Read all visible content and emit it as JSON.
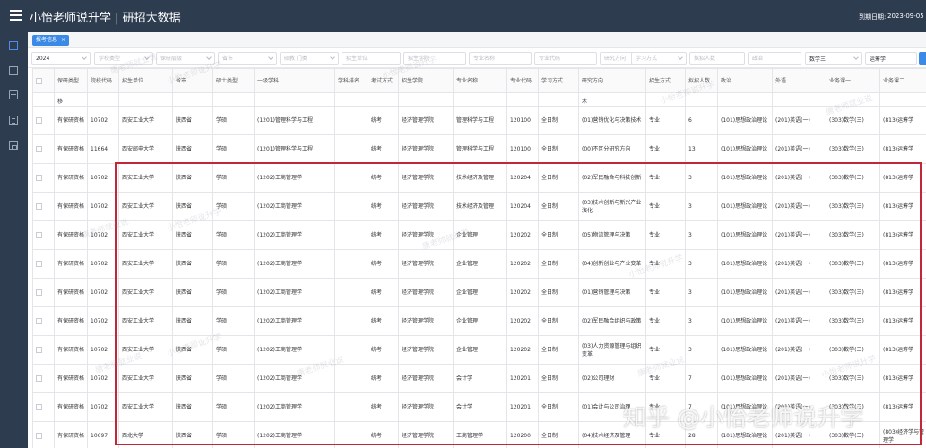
{
  "header": {
    "title": "小怡老师说升学 | 研招大数据",
    "report_date_label": "到期日期:",
    "report_date_value": "2023-09-05 17"
  },
  "tab": {
    "label": "报考信息",
    "close": "×"
  },
  "filters": [
    {
      "id": "year",
      "value": "2024",
      "placeholder": "",
      "has_chevron": true
    },
    {
      "id": "category",
      "value": "",
      "placeholder": "学校类型",
      "has_chevron": true
    },
    {
      "id": "level",
      "value": "",
      "placeholder": "保研层级",
      "has_chevron": true
    },
    {
      "id": "province",
      "value": "",
      "placeholder": "省市",
      "has_chevron": true
    },
    {
      "id": "program",
      "value": "",
      "placeholder": "硕教 门类",
      "has_chevron": true
    },
    {
      "id": "unit",
      "value": "",
      "placeholder": "招生单位",
      "has_chevron": false
    },
    {
      "id": "school",
      "value": "",
      "placeholder": "招生学院",
      "has_chevron": false
    },
    {
      "id": "major",
      "value": "",
      "placeholder": "专业名称",
      "has_chevron": false
    },
    {
      "id": "code",
      "value": "",
      "placeholder": "专业代码",
      "has_chevron": false
    },
    {
      "id": "direction",
      "value": "",
      "placeholder": "研究方向",
      "has_chevron": false
    },
    {
      "id": "mode",
      "value": "",
      "placeholder": "学习方式",
      "has_chevron": true
    },
    {
      "id": "plan",
      "value": "",
      "placeholder": "拟招人数",
      "has_chevron": false
    },
    {
      "id": "politics",
      "value": "",
      "placeholder": "政治",
      "has_chevron": false
    },
    {
      "id": "math",
      "value": "数学三",
      "placeholder": "",
      "has_chevron": true
    },
    {
      "id": "subject2",
      "value": "运筹学",
      "placeholder": "",
      "has_chevron": false
    }
  ],
  "table": {
    "columns": [
      "",
      "保研类型",
      "院校代码",
      "招生单位",
      "省市",
      "硕士类型",
      "一级学科",
      "学科排名",
      "考试方式",
      "招生学院",
      "专业名称",
      "专业代码",
      "学习方式",
      "研究方向",
      "招生方式",
      "拟招人数",
      "政治",
      "外语",
      "业务课一",
      "业务课二"
    ],
    "partial_row": [
      "",
      "移",
      "",
      "",
      "",
      "",
      "",
      "",
      "",
      "",
      "",
      "",
      "",
      "术",
      "",
      "",
      "",
      "",
      "",
      ""
    ],
    "rows": [
      [
        "",
        "有保研资格",
        "10702",
        "西安工业大学",
        "陕西省",
        "学硕",
        "(1201)管理科学与工程",
        "",
        "统考",
        "经济管理学院",
        "管理科学与工程",
        "120100",
        "全日制",
        "(01)营销优化与决策技术",
        "专业",
        "6",
        "(101)思想政治理论",
        "(201)英语(一)",
        "(303)数学(三)",
        "(813)运筹学"
      ],
      [
        "",
        "有保研资格",
        "11664",
        "西安邮电大学",
        "陕西省",
        "学硕",
        "(1201)管理科学与工程",
        "",
        "统考",
        "经济管理学院",
        "管理科学与工程",
        "120100",
        "全日制",
        "(00)不区分研究方向",
        "专业",
        "13",
        "(101)思想政治理论",
        "(201)英语(一)",
        "(303)数学(三)",
        "(813)运筹学"
      ],
      [
        "",
        "有保研资格",
        "10702",
        "西安工业大学",
        "陕西省",
        "学硕",
        "(1202)工商管理学",
        "",
        "统考",
        "经济管理学院",
        "技术经济及管理",
        "120204",
        "全日制",
        "(02)军民融合与科技创新",
        "专业",
        "3",
        "(101)思想政治理论",
        "(201)英语(一)",
        "(303)数学(三)",
        "(813)运筹学"
      ],
      [
        "",
        "有保研资格",
        "10702",
        "西安工业大学",
        "陕西省",
        "学硕",
        "(1202)工商管理学",
        "",
        "统考",
        "经济管理学院",
        "技术经济及管理",
        "120204",
        "全日制",
        "(03)技术创新与新兴产业演化",
        "专业",
        "3",
        "(101)思想政治理论",
        "(201)英语(一)",
        "(303)数学(三)",
        "(813)运筹学"
      ],
      [
        "",
        "有保研资格",
        "10702",
        "西安工业大学",
        "陕西省",
        "学硕",
        "(1202)工商管理学",
        "",
        "统考",
        "经济管理学院",
        "企业管理",
        "120202",
        "全日制",
        "(05)物流管理与决策",
        "专业",
        "3",
        "(101)思想政治理论",
        "(201)英语(一)",
        "(303)数学(三)",
        "(813)运筹学"
      ],
      [
        "",
        "有保研资格",
        "10702",
        "西安工业大学",
        "陕西省",
        "学硕",
        "(1202)工商管理学",
        "",
        "统考",
        "经济管理学院",
        "企业管理",
        "120202",
        "全日制",
        "(04)创新创业与产业变革",
        "专业",
        "3",
        "(101)思想政治理论",
        "(201)英语(一)",
        "(303)数学(三)",
        "(813)运筹学"
      ],
      [
        "",
        "有保研资格",
        "10702",
        "西安工业大学",
        "陕西省",
        "学硕",
        "(1202)工商管理学",
        "",
        "统考",
        "经济管理学院",
        "企业管理",
        "120202",
        "全日制",
        "(01)营销管理与决策",
        "专业",
        "3",
        "(101)思想政治理论",
        "(201)英语(一)",
        "(303)数学(三)",
        "(813)运筹学"
      ],
      [
        "",
        "有保研资格",
        "10702",
        "西安工业大学",
        "陕西省",
        "学硕",
        "(1202)工商管理学",
        "",
        "统考",
        "经济管理学院",
        "企业管理",
        "120202",
        "全日制",
        "(02)军民融合组织与政策",
        "专业",
        "3",
        "(101)思想政治理论",
        "(201)英语(一)",
        "(303)数学(三)",
        "(813)运筹学"
      ],
      [
        "",
        "有保研资格",
        "10702",
        "西安工业大学",
        "陕西省",
        "学硕",
        "(1202)工商管理学",
        "",
        "统考",
        "经济管理学院",
        "企业管理",
        "120202",
        "全日制",
        "(03)人力资源管理与组织变革",
        "专业",
        "3",
        "(101)思想政治理论",
        "(201)英语(一)",
        "(303)数学(三)",
        "(813)运筹学"
      ],
      [
        "",
        "有保研资格",
        "10702",
        "西安工业大学",
        "陕西省",
        "学硕",
        "(1202)工商管理学",
        "",
        "统考",
        "经济管理学院",
        "会计学",
        "120201",
        "全日制",
        "(02)公司理财",
        "专业",
        "7",
        "(101)思想政治理论",
        "(201)英语(一)",
        "(303)数学(三)",
        "(813)运筹学"
      ],
      [
        "",
        "有保研资格",
        "10702",
        "西安工业大学",
        "陕西省",
        "学硕",
        "(1202)工商管理学",
        "",
        "统考",
        "经济管理学院",
        "会计学",
        "120201",
        "全日制",
        "(01)会计与公司治理",
        "专业",
        "7",
        "(101)思想政治理论",
        "(201)英语(一)",
        "(303)数学(三)",
        "(813)运筹学"
      ],
      [
        "",
        "有保研资格",
        "10697",
        "西北大学",
        "陕西省",
        "学硕",
        "(1202)工商管理学",
        "",
        "统考",
        "经济管理学院",
        "工商管理学",
        "120200",
        "全日制",
        "(04)技术经济及管理",
        "专业",
        "28",
        "(101)思想政治理论",
        "(201)英语(一)",
        "(303)数学(三)",
        "(803)经济学与管理学"
      ]
    ]
  },
  "watermarks": {
    "diagonal": [
      "唐老师就业说",
      "小怡老师说升学"
    ],
    "brand": "知乎 @小怡老师说升学"
  }
}
